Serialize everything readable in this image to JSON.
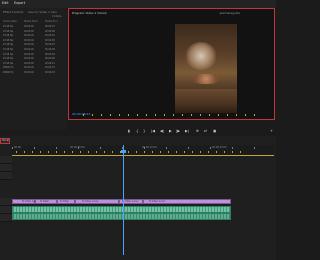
{
  "topbar": {
    "tabs": [
      "Edit",
      "Export"
    ]
  },
  "left_panel": {
    "sub_tabs": [
      "Effect Controls",
      "Source: Video 1.mov"
    ],
    "count": "11 items",
    "columns": [
      "Frame Rate",
      "Media Start",
      "Media End"
    ],
    "rows": [
      [
        "23.98 fps",
        "00:00:00",
        "00:00:12"
      ],
      [
        "23.98 fps",
        "00:00:00",
        "00:00:08"
      ],
      [
        "23.98 fps",
        "00:00:00",
        "00:00:10"
      ],
      [
        "23.98 fps",
        "00:00:00",
        "00:00:05"
      ],
      [
        "23.98 fps",
        "00:00:00",
        "00:00:07"
      ],
      [
        "23.98 fps",
        "00:00:00",
        "00:00:09"
      ],
      [
        "23.98 fps",
        "00:00:00",
        "00:00:04"
      ],
      [
        "23.98 fps",
        "00:00:00",
        "00:00:06"
      ],
      [
        "23.98 fps",
        "00:00:00",
        "00:00:11"
      ],
      [
        "48000 Hz",
        "00:00:00",
        "00:00:13"
      ],
      [
        "48000 Hz",
        "00:00:00",
        "00:00:03"
      ]
    ]
  },
  "monitor": {
    "title": "Program: Video 1  (Vocal)",
    "brand": "premiereguide",
    "timecode": "00:00:08:23"
  },
  "transport": {
    "buttons": [
      "▮",
      "{",
      "}",
      "|◀",
      "◀|",
      "▶",
      "|▶",
      "▶|",
      "⊕",
      "⇄",
      "▣",
      "+"
    ]
  },
  "timeline": {
    "seq_label": "Vocal",
    "ruler_labels": [
      "00:00",
      "00:00:05:00",
      "00:00:10:00",
      "00:00:15:00"
    ],
    "clips": [
      {
        "label": "fx  Video 1.mov"
      },
      {
        "label": "fx  Video"
      },
      {
        "label": "fx  Video"
      },
      {
        "label": "fx  Video 1.mov"
      },
      {
        "label": "fx  Video 1.mov"
      },
      {
        "label": "fx  Video 1.mov"
      }
    ]
  }
}
